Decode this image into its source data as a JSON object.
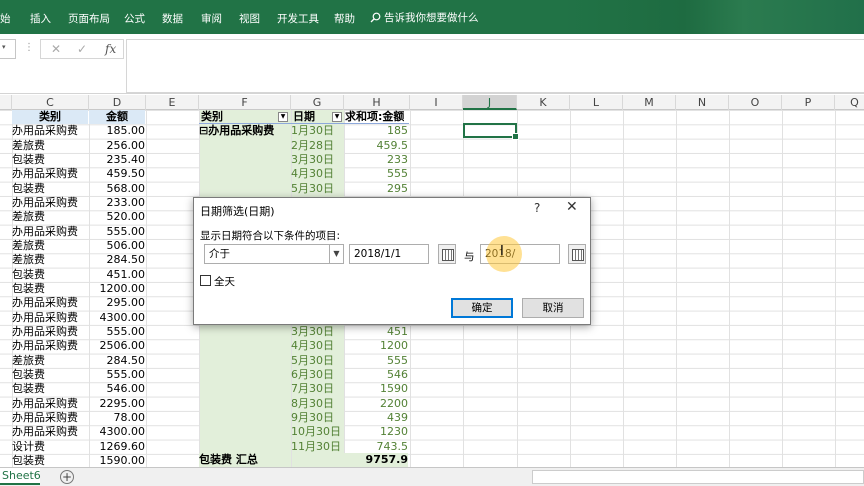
{
  "ribbon": {
    "tabs": [
      "始",
      "插入",
      "页面布局",
      "公式",
      "数据",
      "审阅",
      "视图",
      "开发工具",
      "帮助"
    ],
    "tell_me": "告诉我你想要做什么"
  },
  "formula": {
    "fx": "fx",
    "cancel": "✕",
    "enter": "✓"
  },
  "columns": [
    "C",
    "D",
    "E",
    "F",
    "G",
    "H",
    "I",
    "J",
    "K",
    "L",
    "M",
    "N",
    "O",
    "P",
    "Q"
  ],
  "source_table": {
    "headers": [
      "类别",
      "金额"
    ],
    "rows": [
      [
        "办用品采购费",
        "185.00"
      ],
      [
        "差旅费",
        "256.00"
      ],
      [
        "包装费",
        "235.40"
      ],
      [
        "办用品采购费",
        "459.50"
      ],
      [
        "包装费",
        "568.00"
      ],
      [
        "办用品采购费",
        "233.00"
      ],
      [
        "差旅费",
        "520.00"
      ],
      [
        "办用品采购费",
        "555.00"
      ],
      [
        "差旅费",
        "506.00"
      ],
      [
        "差旅费",
        "284.50"
      ],
      [
        "包装费",
        "451.00"
      ],
      [
        "包装费",
        "1200.00"
      ],
      [
        "办用品采购费",
        "295.00"
      ],
      [
        "办用品采购费",
        "4300.00"
      ],
      [
        "办用品采购费",
        "555.00"
      ],
      [
        "办用品采购费",
        "2506.00"
      ],
      [
        "差旅费",
        "284.50"
      ],
      [
        "包装费",
        "555.00"
      ],
      [
        "包装费",
        "546.00"
      ],
      [
        "办用品采购费",
        "2295.00"
      ],
      [
        "办用品采购费",
        "78.00"
      ],
      [
        "办用品采购费",
        "4300.00"
      ],
      [
        "设计费",
        "1269.60"
      ],
      [
        "包装费",
        "1590.00"
      ]
    ]
  },
  "pivot": {
    "headers": [
      "类别",
      "日期",
      "求和项:金额"
    ],
    "group_label": "⊟办用品采购费",
    "top_rows": [
      [
        "1月30日",
        "185"
      ],
      [
        "2月28日",
        "459.5"
      ],
      [
        "3月30日",
        "233"
      ],
      [
        "4月30日",
        "555"
      ],
      [
        "5月30日",
        "295"
      ]
    ],
    "bottom_rows": [
      [
        "3月30日",
        "451"
      ],
      [
        "4月30日",
        "1200"
      ],
      [
        "5月30日",
        "555"
      ],
      [
        "6月30日",
        "546"
      ],
      [
        "7月30日",
        "1590"
      ],
      [
        "8月30日",
        "2200"
      ],
      [
        "9月30日",
        "439"
      ],
      [
        "10月30日",
        "1230"
      ],
      [
        "11月30日",
        "743.5"
      ]
    ],
    "total_label": "包装费 汇总",
    "total_value": "9757.9"
  },
  "dialog": {
    "title": "日期筛选(日期)",
    "help": "?",
    "close": "✕",
    "condition_label": "显示日期符合以下条件的项目:",
    "operator": "介于",
    "date_from": "2018/1/1",
    "and_label": "与",
    "date_to": "2018/",
    "select_all": "全天",
    "ok": "确定",
    "cancel": "取消"
  },
  "status": {
    "sheet": "Sheet6",
    "add": "+"
  }
}
